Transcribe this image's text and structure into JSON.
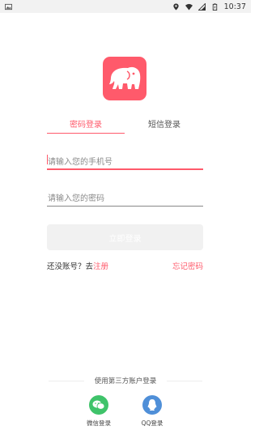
{
  "status_bar": {
    "time": "10:37",
    "icons": [
      "image-icon",
      "location-icon",
      "wifi-icon",
      "signal-icon",
      "battery-icon"
    ]
  },
  "logo": {
    "icon": "elephant-logo-icon",
    "color": "#ff5a6b"
  },
  "tabs": [
    {
      "label": "密码登录",
      "active": true
    },
    {
      "label": "短信登录",
      "active": false
    }
  ],
  "phone_field": {
    "placeholder": "请输入您的手机号",
    "value": ""
  },
  "password_field": {
    "placeholder": "请输入您的密码",
    "value": ""
  },
  "login_button": {
    "label": "立即登录"
  },
  "register": {
    "prompt": "还没账号？去",
    "link": "注册"
  },
  "forgot_password": "忘记密码",
  "third_party": {
    "title": "使用第三方账户登录",
    "wechat": {
      "label": "微信登录",
      "color": "#3fc36a",
      "icon": "wechat-icon"
    },
    "qq": {
      "label": "QQ登录",
      "color": "#4f8fd8",
      "icon": "qq-icon"
    }
  },
  "accent_color": "#ff5a6b"
}
